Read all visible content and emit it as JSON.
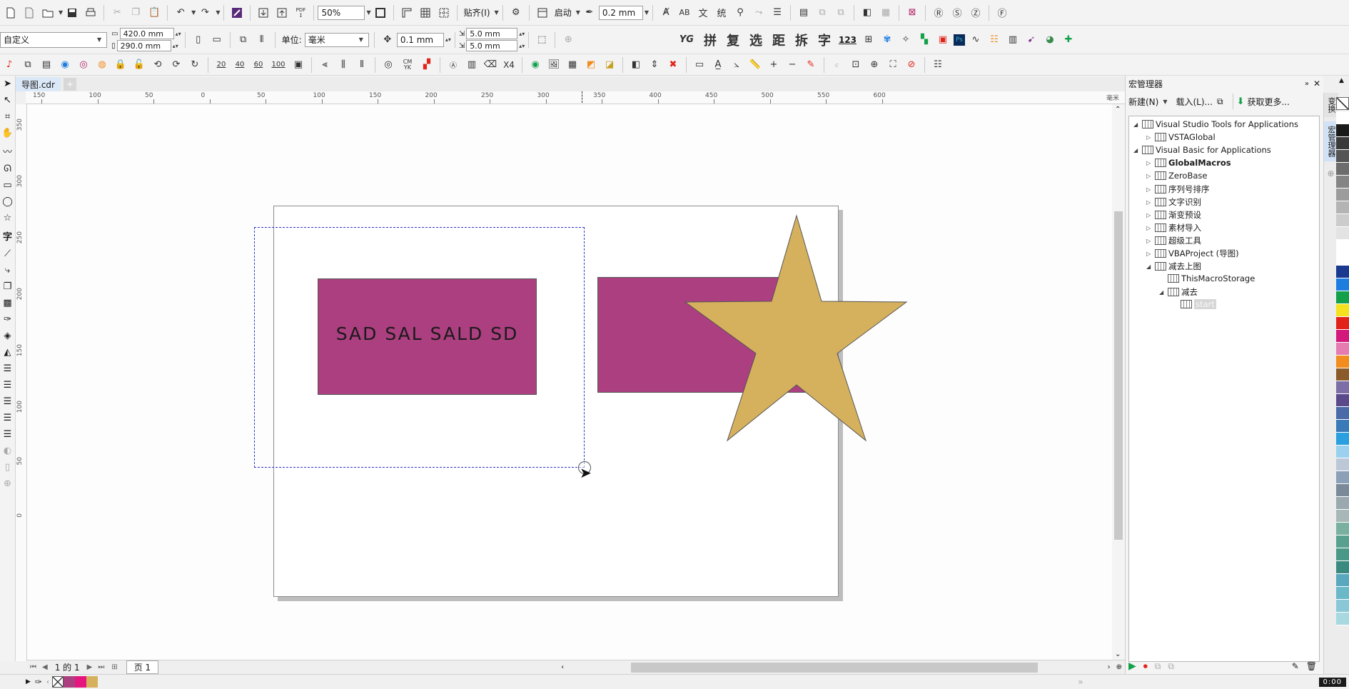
{
  "document": {
    "tab": "导图.cdr",
    "page_tab": "页 1",
    "page_counter": "1 的 1"
  },
  "toolbar": {
    "zoom": "50%",
    "snap_label": "贴齐(I)",
    "launch_label": "启动",
    "outline_width": "0.2 mm",
    "pdf_label": "PDF"
  },
  "propbar": {
    "preset": "自定义",
    "width": "420.0 mm",
    "height": "290.0 mm",
    "unit_label": "单位:",
    "unit_value": "毫米",
    "nudge": "0.1 mm",
    "dup_x": "5.0 mm",
    "dup_y": "5.0 mm",
    "cjk_tools": [
      "拼",
      "复",
      "选",
      "距",
      "拆",
      "字"
    ],
    "yg": "YG",
    "num123": "123"
  },
  "iconbar3": {
    "sizes": [
      "20",
      "40",
      "60",
      "100"
    ],
    "cmyk": "CM YK",
    "x4": "X4"
  },
  "ruler": {
    "h_labels": [
      "150",
      "100",
      "50",
      "0",
      "50",
      "100",
      "150",
      "200",
      "250",
      "300",
      "350",
      "400",
      "450",
      "500",
      "550",
      "600"
    ],
    "unit": "毫米",
    "v_labels": [
      "350",
      "300",
      "250",
      "200",
      "150",
      "100",
      "50",
      "0"
    ]
  },
  "canvas": {
    "text_object": "SAD SAL SALD SD",
    "rect_color": "#ac3f80",
    "star_color": "#d6b15d",
    "selection_color": "#2f37c8"
  },
  "macro_manager": {
    "title": "宏管理器",
    "new_btn": "新建(N)",
    "load_btn": "载入(L)...",
    "get_more_btn": "获取更多...",
    "side_tabs": [
      "变换",
      "宏管理器"
    ],
    "tree": [
      {
        "label": "Visual Studio Tools for Applications",
        "level": 0,
        "expanded": true
      },
      {
        "label": "VSTAGlobal",
        "level": 1,
        "expanded": false
      },
      {
        "label": "Visual Basic for Applications",
        "level": 0,
        "expanded": true
      },
      {
        "label": "GlobalMacros",
        "level": 1,
        "expanded": false,
        "bold": true
      },
      {
        "label": "ZeroBase",
        "level": 1,
        "expanded": false
      },
      {
        "label": "序列号排序",
        "level": 1,
        "expanded": false
      },
      {
        "label": "文字识别",
        "level": 1,
        "expanded": false
      },
      {
        "label": "渐变预设",
        "level": 1,
        "expanded": false
      },
      {
        "label": "素材导入",
        "level": 1,
        "expanded": false
      },
      {
        "label": "超级工具",
        "level": 1,
        "expanded": false
      },
      {
        "label": "VBAProject (导图)",
        "level": 1,
        "expanded": false
      },
      {
        "label": "减去上图",
        "level": 1,
        "expanded": true
      },
      {
        "label": "ThisMacroStorage",
        "level": 2,
        "leaf": true
      },
      {
        "label": "减去",
        "level": 2,
        "expanded": true
      },
      {
        "label": "start",
        "level": 3,
        "leaf": true,
        "selected": true
      }
    ]
  },
  "palette": [
    "#ffffff",
    "#1a1a1a",
    "#3a3a3a",
    "#555555",
    "#6d6d6d",
    "#858585",
    "#9c9c9c",
    "#b4b4b4",
    "#cccccc",
    "#e3e3e3",
    "#ffffff",
    "#ffffff",
    "#1a3a8f",
    "#1e7ee0",
    "#14a04a",
    "#f5e11e",
    "#e2231a",
    "#d4197c",
    "#e57bb0",
    "#f28c1e",
    "#8b5a2b",
    "#7d6ea8",
    "#5a4a8c",
    "#4a6aa8",
    "#3a7ab8",
    "#2aa0e0",
    "#9bd0f0",
    "#bcc8d8",
    "#8ca0b8",
    "#7a8a98",
    "#9aa8b0",
    "#a8b8b8",
    "#7ab0a0",
    "#5aa090",
    "#4a9888",
    "#3a8a80",
    "#5aa8c0",
    "#6ab8c8",
    "#8ac8d8",
    "#a8d8e0"
  ],
  "statusbar": {
    "time": "0:00",
    "doc_colors": [
      "#ac3f80",
      "#e5177e",
      "#d6b15d"
    ]
  }
}
